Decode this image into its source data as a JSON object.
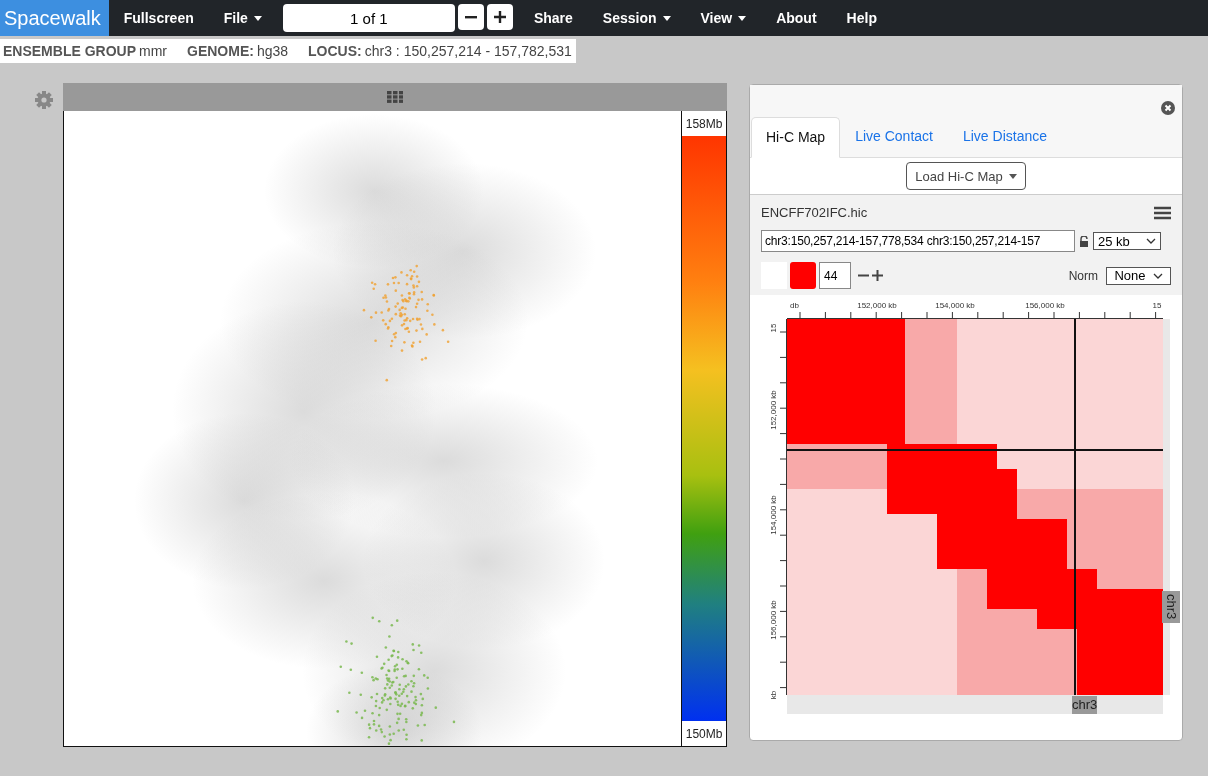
{
  "navbar": {
    "brand": "Spacewalk",
    "items_left": [
      {
        "label": "Fullscreen",
        "dropdown": false
      },
      {
        "label": "File",
        "dropdown": true
      }
    ],
    "stepper": {
      "value": "1 of 1"
    },
    "items_right": [
      {
        "label": "Share",
        "dropdown": false
      },
      {
        "label": "Session",
        "dropdown": true
      },
      {
        "label": "View",
        "dropdown": true
      },
      {
        "label": "About",
        "dropdown": false
      },
      {
        "label": "Help",
        "dropdown": false
      }
    ]
  },
  "info_bar": [
    {
      "label": "ENSEMBLE GROUP",
      "value": "mmr"
    },
    {
      "label": "GENOME:",
      "value": "hg38"
    },
    {
      "label": "LOCUS:",
      "value": "chr3 : 150,257,214 - 157,782,531"
    }
  ],
  "viewer": {
    "colorbar_top": "158Mb",
    "colorbar_bottom": "150Mb"
  },
  "hic_panel": {
    "tabs": [
      {
        "label": "Hi-C Map",
        "selected": true
      },
      {
        "label": "Live Contact",
        "selected": false
      },
      {
        "label": "Live Distance",
        "selected": false
      }
    ],
    "load_button": "Load Hi-C Map",
    "file_name": "ENCFF702IFC.hic",
    "locus": "chr3:150,257,214-157,778,534 chr3:150,257,214-157",
    "resolution": "25 kb",
    "color_threshold": "44",
    "norm_label": "Norm",
    "norm_value": "None",
    "x_ticks": [
      "db",
      "152,000 kb",
      "154,000 kb",
      "156,000 kb",
      "15"
    ],
    "y_ticks": [
      "15",
      "152,000 kb",
      "154,000 kb",
      "156,000 kb",
      "kb"
    ],
    "x_chrom": "chr3",
    "y_chrom": "chr3"
  }
}
